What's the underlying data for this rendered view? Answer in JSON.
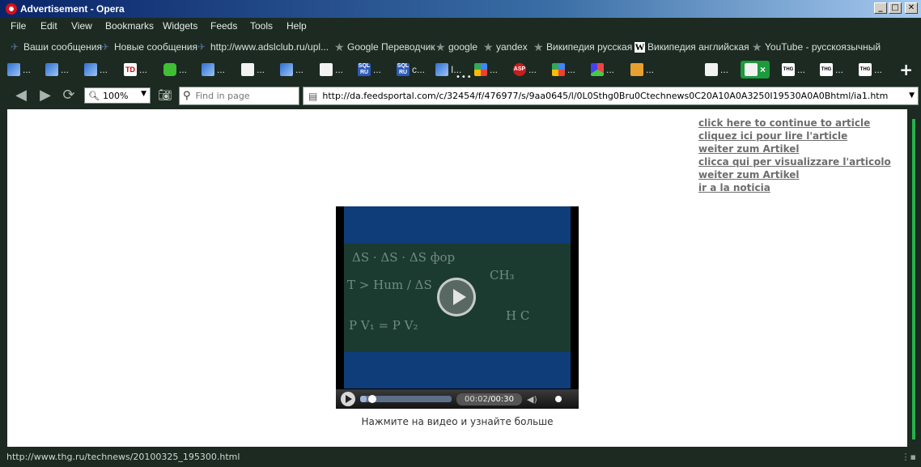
{
  "window": {
    "title": "Advertisement - Opera",
    "buttons": [
      "_",
      "□",
      "✕"
    ]
  },
  "menu": [
    "File",
    "Edit",
    "View",
    "Bookmarks",
    "Widgets",
    "Feeds",
    "Tools",
    "Help"
  ],
  "bookmarks": [
    {
      "label": "Ваши сообщения",
      "icon": "plane-icon"
    },
    {
      "label": "Новые сообщения",
      "icon": "plane-icon"
    },
    {
      "label": "http://www.adslclub.ru/upl...",
      "icon": "plane-icon"
    },
    {
      "label": "Google Переводчик",
      "icon": "star-icon"
    },
    {
      "label": "google",
      "icon": "star-icon"
    },
    {
      "label": "yandex",
      "icon": "star-icon"
    },
    {
      "label": "Википедия русская",
      "icon": "star-icon"
    },
    {
      "label": "Википедия английская",
      "icon": "wikipedia-icon"
    },
    {
      "label": "YouTube - русскоязычный",
      "icon": "star-icon"
    }
  ],
  "tabs": [
    {
      "label": "...",
      "favicon": "blue"
    },
    {
      "label": "...",
      "favicon": "blue"
    },
    {
      "label": "...",
      "favicon": "blue"
    },
    {
      "label": "...",
      "favicon": "td",
      "favicon_text": "TD"
    },
    {
      "label": "...",
      "favicon": "green"
    },
    {
      "label": "...",
      "favicon": "blue"
    },
    {
      "label": "...",
      "favicon": "doc"
    },
    {
      "label": "...",
      "favicon": "blue"
    },
    {
      "label": "...",
      "favicon": "doc"
    },
    {
      "label": "...",
      "favicon": "sql",
      "favicon_text": "SQL RU"
    },
    {
      "label": "c...",
      "favicon": "sql",
      "favicon_text": "SQL RU"
    },
    {
      "label": "I...",
      "favicon": "blue"
    },
    {
      "label": "...",
      "favicon": "g"
    },
    {
      "label": "...",
      "favicon": "asp",
      "favicon_text": "ASP"
    },
    {
      "label": "...",
      "favicon": "g"
    },
    {
      "label": "...",
      "favicon": "cube"
    },
    {
      "label": "...",
      "favicon": "pic"
    },
    {
      "label": "...",
      "favicon": "doc"
    },
    {
      "label": "×",
      "favicon": "doc",
      "active": true
    },
    {
      "label": "...",
      "favicon": "thg",
      "favicon_text": "THG"
    },
    {
      "label": "...",
      "favicon": "thg",
      "favicon_text": "THG"
    },
    {
      "label": "...",
      "favicon": "thg",
      "favicon_text": "THG"
    },
    {
      "label": "...",
      "favicon": "thg",
      "favicon_text": "THG"
    }
  ],
  "toolbar": {
    "zoom": "100%",
    "find_placeholder": "Find in page",
    "address": "http://da.feedsportal.com/c/32454/f/476977/s/9aa0645/l/0L0Sthg0Bru0Ctechnews0C20A10A0A3250I19530A0A0Bhtml/ia1.htm"
  },
  "page": {
    "links": [
      "click here to continue to article",
      "cliquez ici pour lire l'article",
      "weiter zum Artikel",
      "clicca qui per visualizzare l'articolo",
      "weiter zum Artikel",
      "ir a la noticia"
    ],
    "video": {
      "current_time": "00:02",
      "total_time": "00:30",
      "progress_fraction": 0.067
    },
    "caption": "Нажмите на видео и узнайте больше"
  },
  "status": {
    "text": "http://www.thg.ru/technews/20100325_195300.html"
  },
  "colors": {
    "chrome_bg": "#1c2a22",
    "active_tab": "#1c9a3c",
    "link": "#6d6d6d",
    "video_band": "#0f3d7a"
  }
}
